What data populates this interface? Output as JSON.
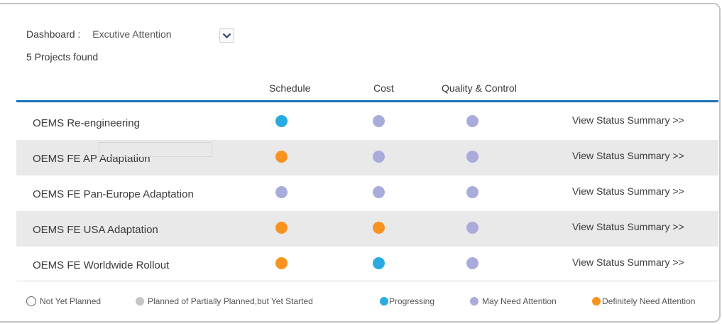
{
  "dashboard": {
    "label": "Dashboard :",
    "selected": "Excutive Attention",
    "count_text": "5 Projects found"
  },
  "columns": {
    "schedule": "Schedule",
    "cost": "Cost",
    "quality": "Quality & Control"
  },
  "status_colors": {
    "progressing": "#29abe2",
    "may_need_attention": "#a9abda",
    "definitely_need_attention": "#f7931e"
  },
  "projects": [
    {
      "name": "OEMS Re-engineering",
      "schedule": "progressing",
      "cost": "may_need_attention",
      "quality": "may_need_attention",
      "link": "View Status Summary >>"
    },
    {
      "name": "OEMS FE AP Adaptation",
      "schedule": "definitely_need_attention",
      "cost": "may_need_attention",
      "quality": "may_need_attention",
      "link": "View Status Summary >>"
    },
    {
      "name": "OEMS FE Pan-Europe Adaptation",
      "schedule": "may_need_attention",
      "cost": "may_need_attention",
      "quality": "may_need_attention",
      "link": "View Status Summary >>"
    },
    {
      "name": "OEMS FE USA Adaptation",
      "schedule": "definitely_need_attention",
      "cost": "definitely_need_attention",
      "quality": "may_need_attention",
      "link": "View Status Summary >>"
    },
    {
      "name": "OEMS FE Worldwide Rollout",
      "schedule": "definitely_need_attention",
      "cost": "progressing",
      "quality": "may_need_attention",
      "link": "View Status Summary >>"
    }
  ],
  "legend": {
    "not_yet_planned": "Not Yet Planned",
    "planned": "Planned of Partially Planned,but Yet Started",
    "progressing": "Progressing",
    "may_need_attention": "May Need Attention",
    "definitely_need_attention": "Definitely Need Attention"
  }
}
